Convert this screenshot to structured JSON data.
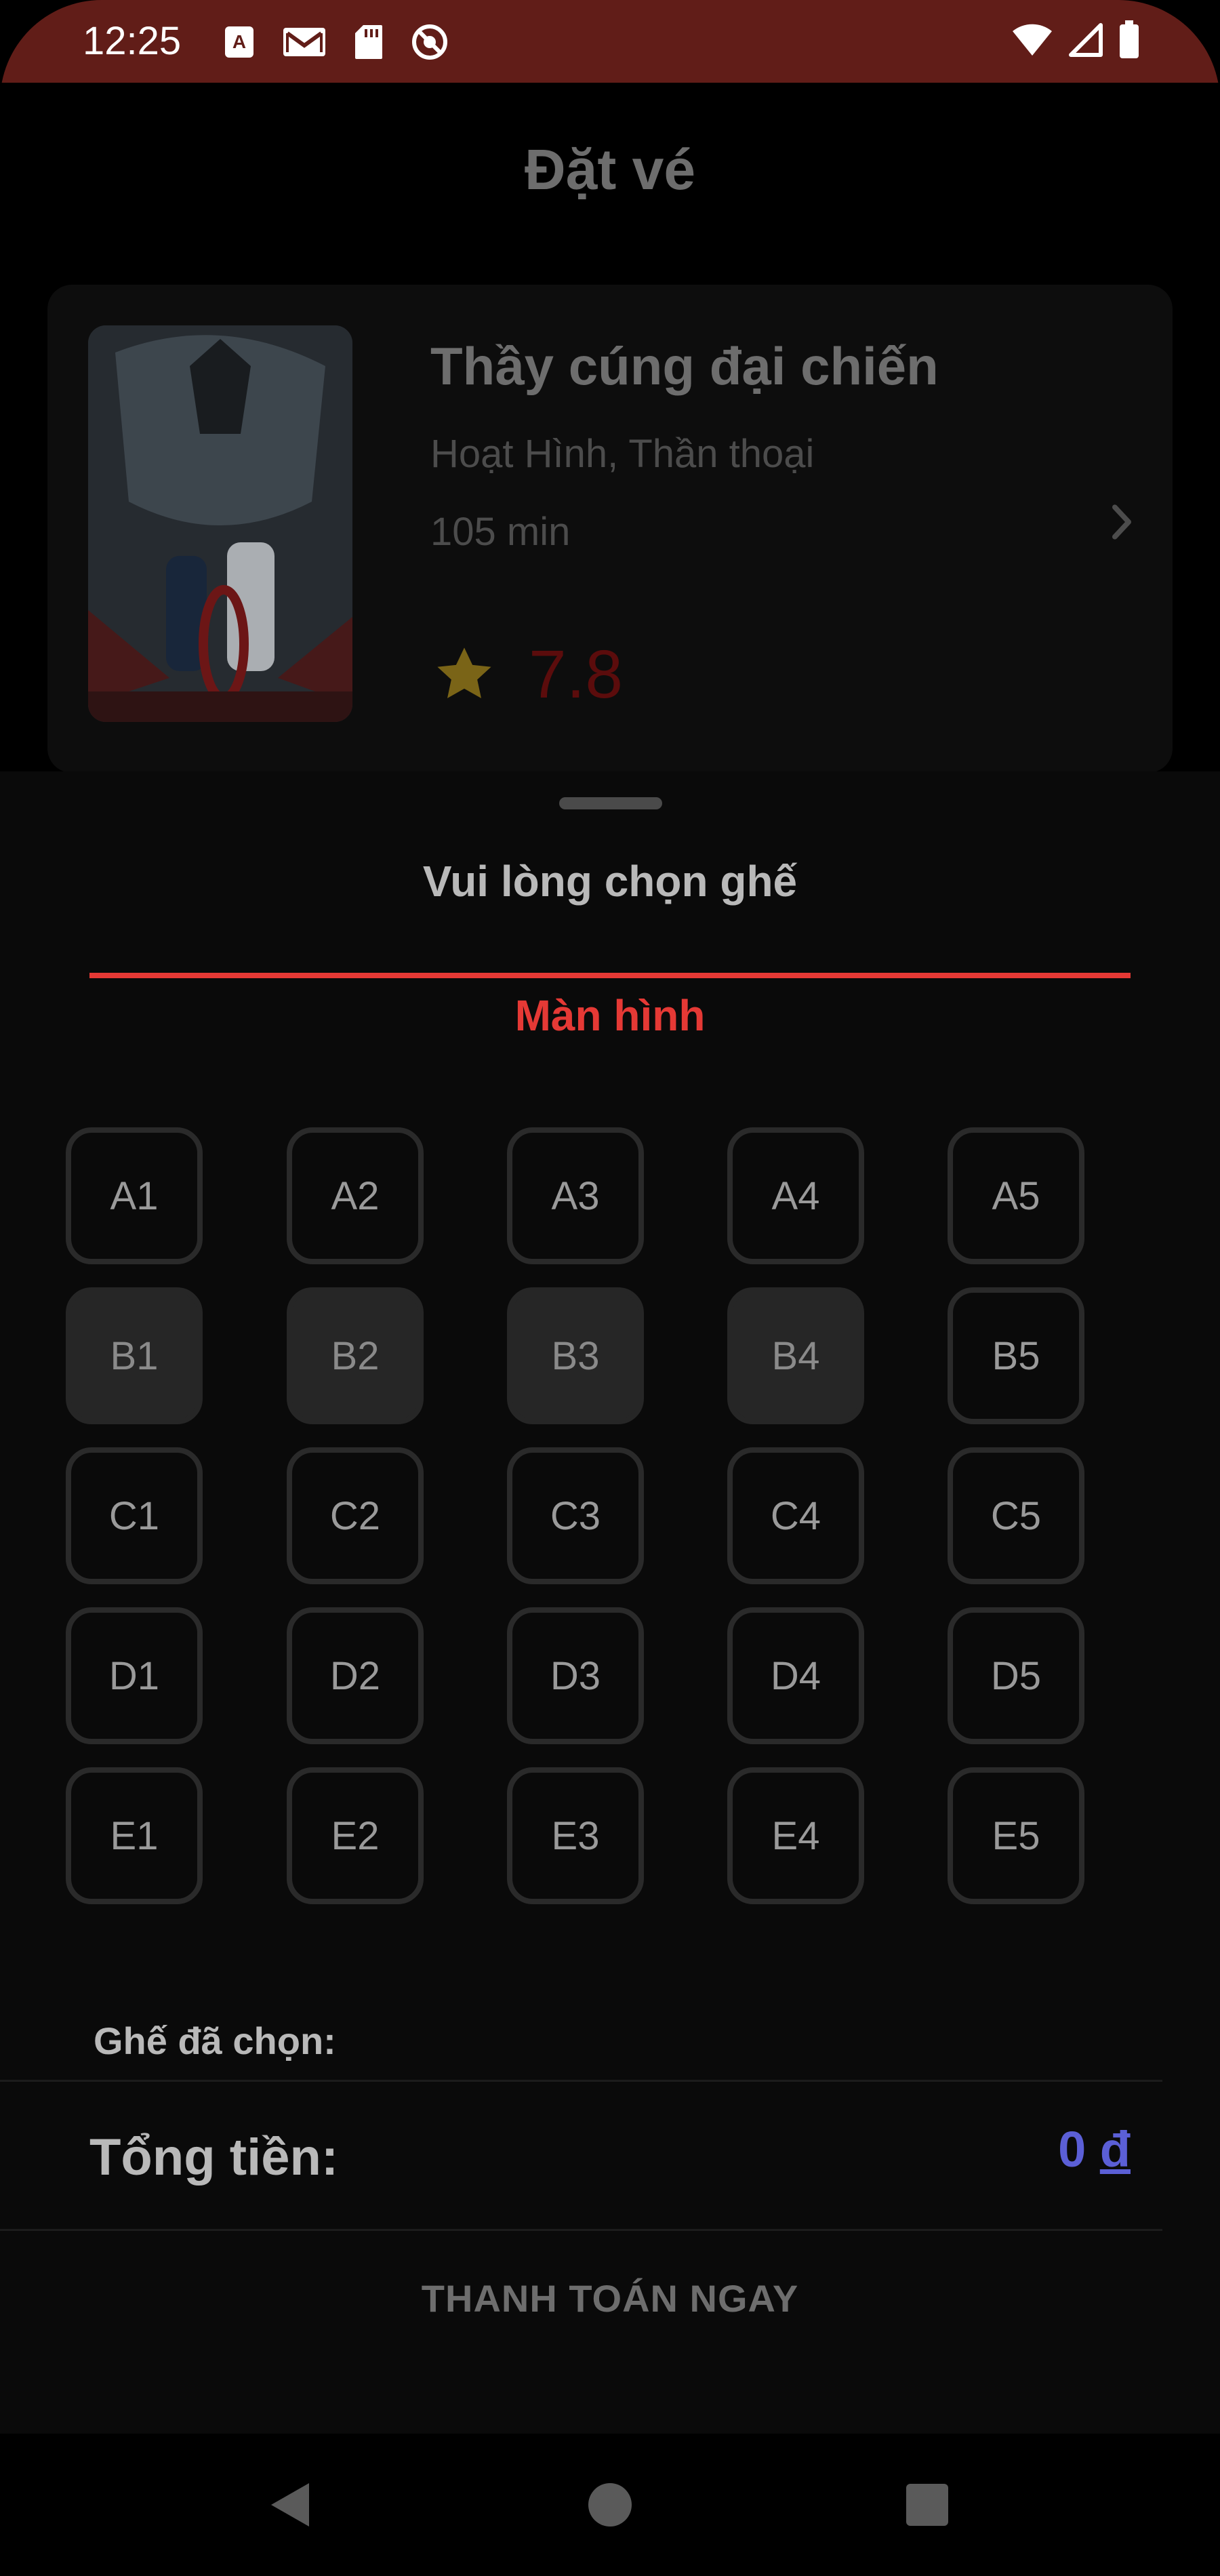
{
  "status_bar": {
    "time": "12:25",
    "left_icons": [
      "text-a-icon",
      "gmail-icon",
      "sd-card-icon",
      "no-disturb-icon"
    ],
    "right_icons": [
      "wifi-icon",
      "signal-icon",
      "battery-icon"
    ],
    "background": "#611d18"
  },
  "header": {
    "title": "Đặt vé"
  },
  "movie": {
    "title": "Thầy cúng đại chiến",
    "genres": "Hoạt Hình, Thần thoại",
    "duration": "105 min",
    "rating": "7.8",
    "rating_icon": "star-icon",
    "poster_icon": "movie-poster-image"
  },
  "sheet": {
    "title": "Vui lòng chọn ghế",
    "screen_label": "Màn hình",
    "seats": [
      {
        "label": "A1",
        "booked": false
      },
      {
        "label": "A2",
        "booked": false
      },
      {
        "label": "A3",
        "booked": false
      },
      {
        "label": "A4",
        "booked": false
      },
      {
        "label": "A5",
        "booked": false
      },
      {
        "label": "B1",
        "booked": true
      },
      {
        "label": "B2",
        "booked": true
      },
      {
        "label": "B3",
        "booked": true
      },
      {
        "label": "B4",
        "booked": true
      },
      {
        "label": "B5",
        "booked": false
      },
      {
        "label": "C1",
        "booked": false
      },
      {
        "label": "C2",
        "booked": false
      },
      {
        "label": "C3",
        "booked": false
      },
      {
        "label": "C4",
        "booked": false
      },
      {
        "label": "C5",
        "booked": false
      },
      {
        "label": "D1",
        "booked": false
      },
      {
        "label": "D2",
        "booked": false
      },
      {
        "label": "D3",
        "booked": false
      },
      {
        "label": "D4",
        "booked": false
      },
      {
        "label": "D5",
        "booked": false
      },
      {
        "label": "E1",
        "booked": false
      },
      {
        "label": "E2",
        "booked": false
      },
      {
        "label": "E3",
        "booked": false
      },
      {
        "label": "E4",
        "booked": false
      },
      {
        "label": "E5",
        "booked": false
      }
    ],
    "selected_label": "Ghế đã chọn:",
    "total_label": "Tổng tiền:",
    "total_amount": "0",
    "total_currency": "đ",
    "pay_button": "THANH TOÁN NGAY"
  },
  "colors": {
    "accent_red": "#e53935",
    "price_blue": "#5b5fd6",
    "rating_red": "#5b0c0c",
    "star_gold": "#7a6417"
  },
  "nav_bar": {
    "buttons": [
      "back-icon",
      "home-icon",
      "recents-icon"
    ]
  }
}
